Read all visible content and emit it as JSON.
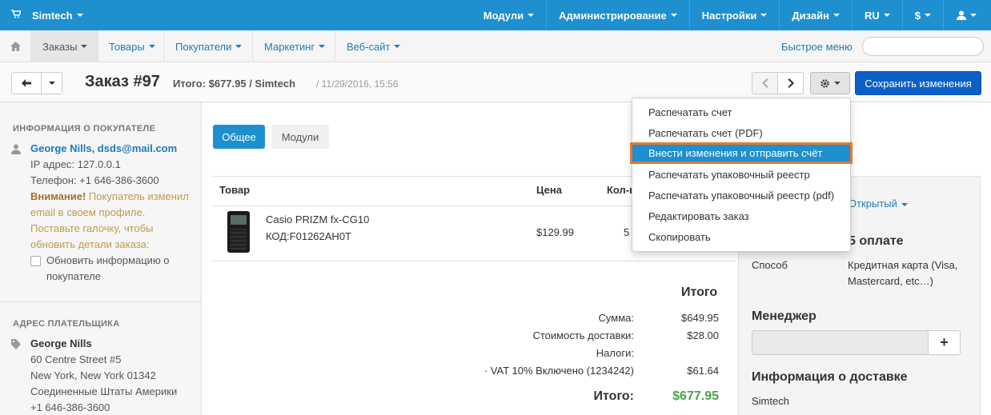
{
  "topbar": {
    "brand": "Simtech",
    "items": [
      "Модули",
      "Администрирование",
      "Настройки",
      "Дизайн",
      "RU",
      "$"
    ]
  },
  "navbar": {
    "items": [
      "Заказы",
      "Товары",
      "Покупатели",
      "Маркетинг",
      "Веб-сайт"
    ],
    "quick_menu": "Быстрое меню",
    "search_placeholder": ""
  },
  "header": {
    "title": "Заказ #97",
    "total": "Итого: $677.95 / Simtech",
    "date": "/ 11/29/2016, 15:56",
    "save_button": "Сохранить изменения"
  },
  "sidebar": {
    "customer_title": "ИНФОРМАЦИЯ О ПОКУПАТЕЛЕ",
    "customer_name_email": "George Nills, dsds@mail.com",
    "ip": "IP адрес: 127.0.0.1",
    "phone": "Телефон: +1 646-386-3600",
    "warning_bold": "Внимание!",
    "warning_line1": " Покупатель изменил",
    "warning_line2": "email в своем профиле.",
    "warning_line3": "Поставьте галочку, чтобы",
    "warning_line4": "обновить детали заказа:",
    "update_line1": "Обновить информацию о",
    "update_line2": "покупателе",
    "billing_title": "АДРЕС ПЛАТЕЛЬЩИКА",
    "billing_name": "George Nills",
    "billing_street": "60 Centre Street #5",
    "billing_city": "New York, New York 01342",
    "billing_country": "Соединенные Штаты Америки",
    "billing_phone": "+1 646-386-3600"
  },
  "main": {
    "tabs": [
      "Общее",
      "Модули"
    ],
    "columns": [
      "Товар",
      "Цена",
      "Кол-в"
    ],
    "product": {
      "name": "Casio PRIZM fx-CG10",
      "code": "КОД:F01262AH0T",
      "price": "$129.99",
      "qty": "5"
    },
    "totals_title": "Итого",
    "totals": [
      {
        "label": "Сумма:",
        "value": "$649.95"
      },
      {
        "label": "Стоимость доставки:",
        "value": "$28.00"
      },
      {
        "label": "Налоги:",
        "value": ""
      },
      {
        "label": "· VAT 10% Включено (1234242)",
        "value": "$61.64"
      }
    ],
    "grand_label": "Итого:",
    "grand_value": "$677.95"
  },
  "rpanel": {
    "status": "Открытый",
    "payment_title": "5 оплате",
    "method_label": "Способ",
    "method_value_1": "Кредитная карта (Visa,",
    "method_value_2": "Mastercard, etc…)",
    "manager_title": "Менеджер",
    "add_label": "+",
    "shipping_title": "Информация о доставке",
    "shipping_value": "Simtech"
  },
  "dropdown": {
    "items": [
      "Распечатать счет",
      "Распечатать счет (PDF)",
      "Внести изменения и отправить счёт",
      "Распечатать упаковочный реестр",
      "Распечатать упаковочный реестр (pdf)",
      "Редактировать заказ",
      "Скопировать"
    ],
    "highlighted_index": 2
  },
  "colors": {
    "topbar": "#1e8fcf",
    "save_button": "#0b5fc7",
    "highlight_border": "#e8792b",
    "grand_total": "#47a447"
  }
}
